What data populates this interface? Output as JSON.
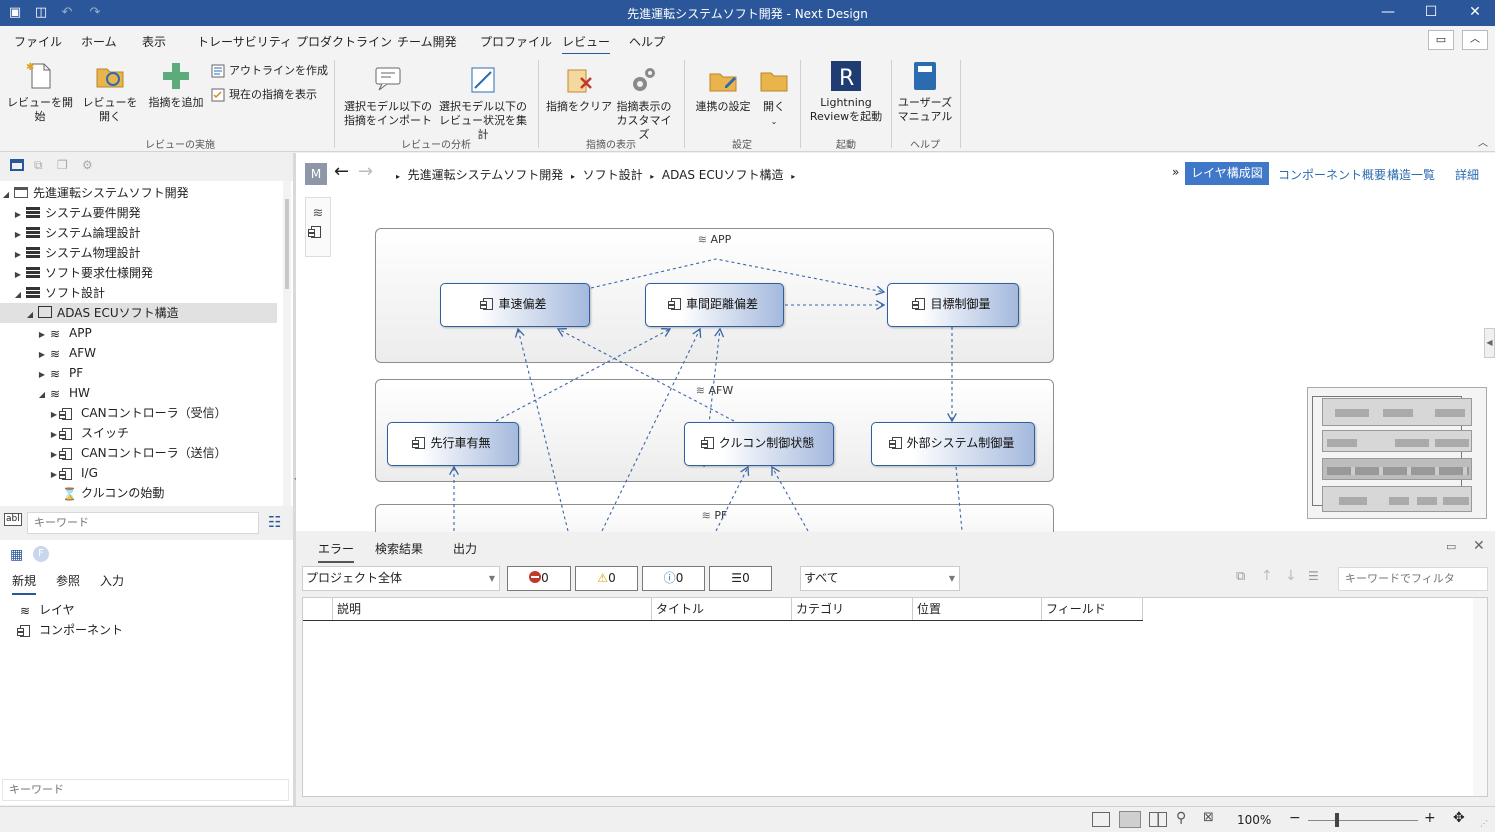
{
  "app": {
    "title": "先進運転システムソフト開発 - Next Design"
  },
  "menus": [
    "ファイル",
    "ホーム",
    "表示",
    "トレーサビリティ",
    "プロダクトライン",
    "チーム開発",
    "プロファイル",
    "レビュー",
    "ヘルプ"
  ],
  "active_menu": "レビュー",
  "ribbon": {
    "start_review": "レビューを開始",
    "open_review": "レビューを開く",
    "add_comment": "指摘を追加",
    "create_outline": "アウトラインを作成",
    "show_current": "現在の指摘を表示",
    "group_exec": "レビューの実施",
    "import1": "選択モデル以下の",
    "import2": "指摘をインポート",
    "aggregate1": "選択モデル以下の",
    "aggregate2": "レビュー状況を集計",
    "group_analysis": "レビューの分析",
    "clear": "指摘をクリア",
    "customize1": "指摘表示の",
    "customize2": "カスタマイズ",
    "group_display": "指摘の表示",
    "link_settings": "連携の設定",
    "open": "開く",
    "group_settings": "設定",
    "lightning1": "Lightning",
    "lightning2": "Reviewを起動",
    "group_launch": "起動",
    "manual1": "ユーザーズ",
    "manual2": "マニュアル",
    "group_help": "ヘルプ"
  },
  "tree": {
    "root": "先進運転システムソフト開発",
    "items": [
      "システム要件開発",
      "システム論理設計",
      "システム物理設計",
      "ソフト要求仕様開発",
      "ソフト設計"
    ],
    "selected": "ADAS ECUソフト構造",
    "layers": [
      "APP",
      "AFW",
      "PF",
      "HW"
    ],
    "hw_children": [
      "CANコントローラ（受信）",
      "スイッチ",
      "CANコントローラ（送信）",
      "I/G"
    ],
    "extra": "クルコンの始動",
    "keyword_placeholder": "キーワード"
  },
  "props": {
    "tabs": [
      "新規",
      "参照",
      "入力"
    ],
    "items": [
      "レイヤ",
      "コンポーネント"
    ],
    "keyword_placeholder": "キーワード"
  },
  "breadcrumb": {
    "m": "M",
    "items": [
      "先進運転システムソフト開発",
      "ソフト設計",
      "ADAS ECUソフト構造"
    ]
  },
  "views": [
    "レイヤ構成図",
    "コンポーネント概要",
    "構造一覧",
    "詳細"
  ],
  "diagram": {
    "layers": [
      "APP",
      "AFW",
      "PF"
    ],
    "components": {
      "speed_dev": "車速偏差",
      "distance_dev": "車間距離偏差",
      "target_control": "目標制御量",
      "lead_vehicle": "先行車有無",
      "cruise_state": "クルコン制御状態",
      "ext_system": "外部システム制御量"
    }
  },
  "bottom": {
    "tabs": [
      "エラー",
      "検索結果",
      "出力"
    ],
    "scope": "プロジェクト全体",
    "errors": "0",
    "warnings": "0",
    "infos": "0",
    "messages": "0",
    "category": "すべて",
    "filter_placeholder": "キーワードでフィルタ",
    "columns": [
      "説明",
      "タイトル",
      "カテゴリ",
      "位置",
      "フィールド"
    ]
  },
  "status": {
    "zoom": "100%"
  },
  "colors": {
    "accent": "#2b579a",
    "component": "#2e5f9e",
    "view_active": "#3f78c8"
  }
}
